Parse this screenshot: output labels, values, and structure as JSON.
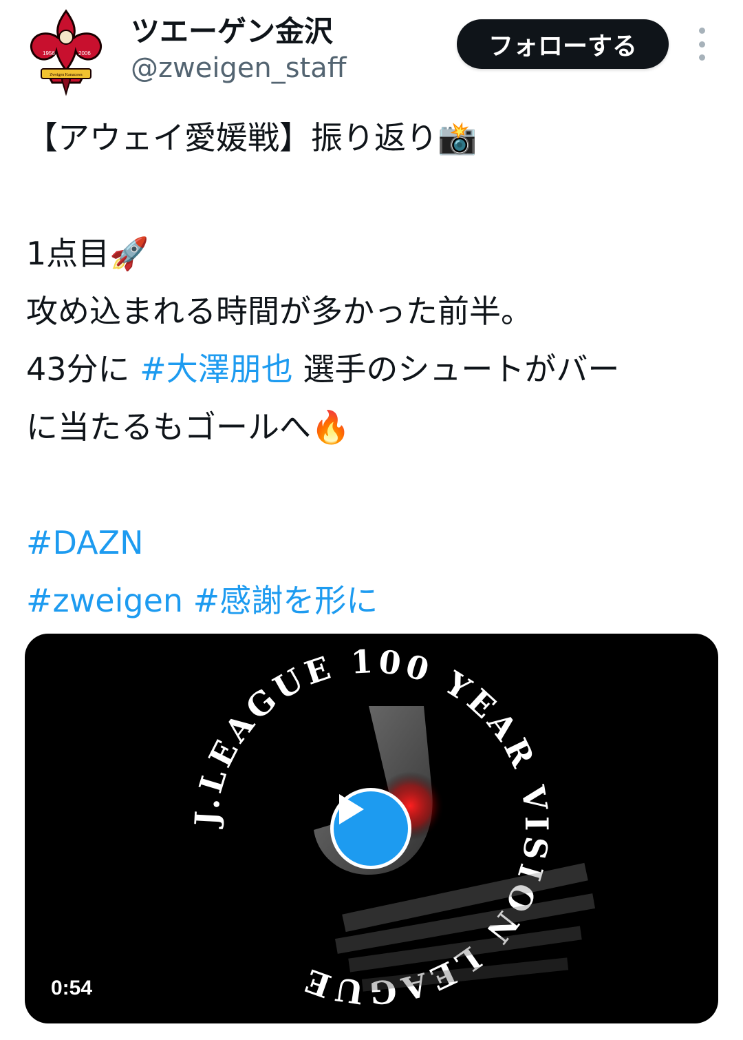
{
  "account": {
    "display_name": "ツエーゲン金沢",
    "handle": "@zweigen_staff",
    "logo_text_left": "1956",
    "logo_text_right": "2006",
    "logo_banner": "Zweigen Kanazawa"
  },
  "actions": {
    "follow_label": "フォローする",
    "more_icon": "more-vertical-icon"
  },
  "tweet": {
    "title": "【アウェイ愛媛戦】振り返り",
    "title_emoji": "📸",
    "line1": "1点目",
    "line1_emoji": "🚀",
    "line2": "攻め込まれる時間が多かった前半。",
    "line3_prefix": "43分に ",
    "line3_hashtag": "#大澤朋也",
    "line3_suffix": " 選手のシュートがバー",
    "line4": "に当たるもゴールへ",
    "line4_emoji": "🔥",
    "hashtag_dazn": "#DAZN",
    "hashtag_zweigen": "#zweigen",
    "hashtag_kansha": "#感謝を形に"
  },
  "video": {
    "ring_text": "J.LEAGUE 100 YEAR VISION LEAGUE",
    "duration": "0:54",
    "play_icon": "play-icon"
  },
  "colors": {
    "hashtag": "#1d9bf0",
    "follow_bg": "#0f1419",
    "logo_red": "#c8102e"
  }
}
